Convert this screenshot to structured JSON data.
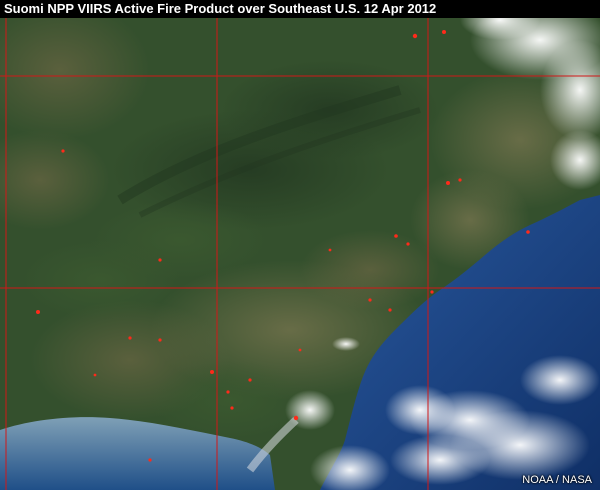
{
  "title": "Suomi NPP VIIRS Active Fire Product over Southeast U.S.  12 Apr 2012",
  "credit": "NOAA / NASA",
  "colors": {
    "land": "#2f4a2a",
    "ocean": "#163a78",
    "grid": "#d01818",
    "fire": "#ff2a1a",
    "cloud": "#f2f4f7"
  }
}
